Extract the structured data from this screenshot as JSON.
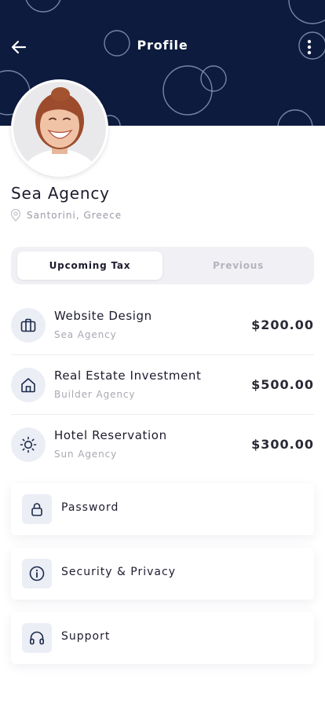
{
  "header": {
    "title": "Profile",
    "back_icon": "arrow-left-icon",
    "more_icon": "more-vertical-icon",
    "background": "#0d1b3e"
  },
  "profile": {
    "name": "Sea Agency",
    "location": "Santorini, Greece",
    "location_icon": "map-pin-icon"
  },
  "tabs": [
    {
      "label": "Upcoming Tax",
      "active": true
    },
    {
      "label": "Previous",
      "active": false
    }
  ],
  "taxes": [
    {
      "title": "Website Design",
      "subtitle": "Sea Agency",
      "amount": "$200.00",
      "icon": "briefcase-icon"
    },
    {
      "title": "Real Estate Investment",
      "subtitle": "Builder Agency",
      "amount": "$500.00",
      "icon": "home-icon"
    },
    {
      "title": "Hotel Reservation",
      "subtitle": "Sun Agency",
      "amount": "$300.00",
      "icon": "sun-icon"
    }
  ],
  "menu": [
    {
      "label": "Password",
      "icon": "lock-icon"
    },
    {
      "label": "Security & Privacy",
      "icon": "info-icon"
    },
    {
      "label": "Support",
      "icon": "headphones-icon"
    }
  ]
}
